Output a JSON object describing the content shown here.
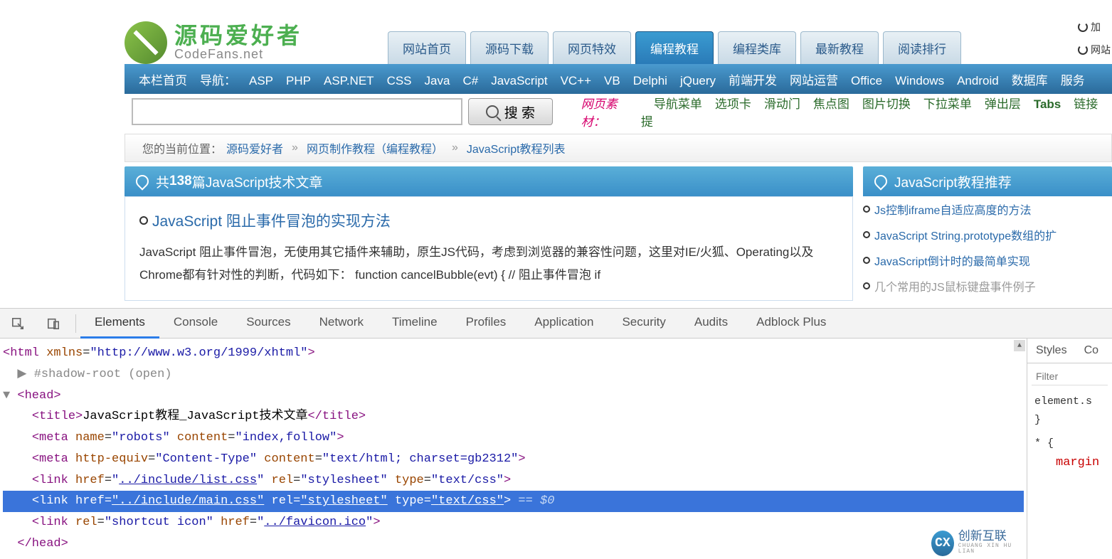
{
  "logo": {
    "cn": "源码爱好者",
    "en": "CodeFans.net"
  },
  "top_right": {
    "add": "加",
    "site": "网站"
  },
  "tabs": [
    {
      "label": "网站首页",
      "active": false
    },
    {
      "label": "源码下载",
      "active": false
    },
    {
      "label": "网页特效",
      "active": false
    },
    {
      "label": "编程教程",
      "active": true
    },
    {
      "label": "编程类库",
      "active": false
    },
    {
      "label": "最新教程",
      "active": false
    },
    {
      "label": "阅读排行",
      "active": false
    }
  ],
  "nav": {
    "home": "本栏首页",
    "label": "导航：",
    "items": [
      "ASP",
      "PHP",
      "ASP.NET",
      "CSS",
      "Java",
      "C#",
      "JavaScript",
      "VC++",
      "VB",
      "Delphi",
      "jQuery",
      "前端开发",
      "网站运营",
      "Office",
      "Windows",
      "Android",
      "数据库",
      "服务"
    ]
  },
  "search": {
    "placeholder": "",
    "button": "搜 索"
  },
  "materials": {
    "label": "网页素材：",
    "links": [
      "导航菜单",
      "选项卡",
      "滑动门",
      "焦点图",
      "图片切换",
      "下拉菜单",
      "弹出层",
      "Tabs",
      "链接提"
    ]
  },
  "breadcrumb": {
    "label": "您的当前位置：",
    "items": [
      "源码爱好者",
      "网页制作教程（编程教程）",
      "JavaScript教程列表"
    ]
  },
  "main_panel": {
    "header_prefix": "共 ",
    "header_count": "138",
    "header_suffix": " 篇JavaScript技术文章",
    "article_title": "JavaScript 阻止事件冒泡的实现方法",
    "article_desc": "JavaScript 阻止事件冒泡，无使用其它插件来辅助，原生JS代码，考虑到浏览器的兼容性问题，这里对IE/火狐、Operating以及Chrome都有针对性的判断，代码如下：  function cancelBubble(evt) { // 阻止事件冒泡 if"
  },
  "side_panel": {
    "header": "JavaScript教程推荐",
    "links": [
      "Js控制iframe自适应高度的方法",
      "JavaScript String.prototype数组的扩",
      "JavaScript倒计时的最简单实现",
      "几个常用的JS鼠标键盘事件例子"
    ]
  },
  "devtools": {
    "tabs": [
      "Elements",
      "Console",
      "Sources",
      "Network",
      "Timeline",
      "Profiles",
      "Application",
      "Security",
      "Audits",
      "Adblock Plus"
    ],
    "active_tab": "Elements",
    "right_tabs": [
      "Styles",
      "Co"
    ],
    "filter_placeholder": "Filter",
    "css": {
      "sel1": "element.s",
      "brace1": "}",
      "sel2": "* {",
      "prop": "margin"
    },
    "dom": {
      "l1": {
        "open": "<html ",
        "attr": "xmlns",
        "val": "http://www.w3.org/1999/xhtml",
        "close": ">"
      },
      "l2": "#shadow-root (open)",
      "l3": "<head>",
      "title_open": "<title>",
      "title_text": "JavaScript教程_JavaScript技术文章",
      "title_close": "</title>",
      "m1": {
        "tag": "meta",
        "a1": "name",
        "v1": "robots",
        "a2": "content",
        "v2": "index,follow"
      },
      "m2": {
        "tag": "meta",
        "a1": "http-equiv",
        "v1": "Content-Type",
        "a2": "content",
        "v2": "text/html; charset=gb2312"
      },
      "link1": {
        "href": "../include/list.css",
        "rel": "stylesheet",
        "type": "text/css"
      },
      "link2": {
        "href": "../include/main.css",
        "rel": "stylesheet",
        "type": "text/css",
        "eq": "== $0"
      },
      "link3": {
        "rel": "shortcut icon",
        "href": "../favicon.ico"
      },
      "head_close": "</head>"
    }
  },
  "watermark": {
    "icon": "CX",
    "cn": "创新互联",
    "en": "CHUANG XIN HU LIAN"
  }
}
